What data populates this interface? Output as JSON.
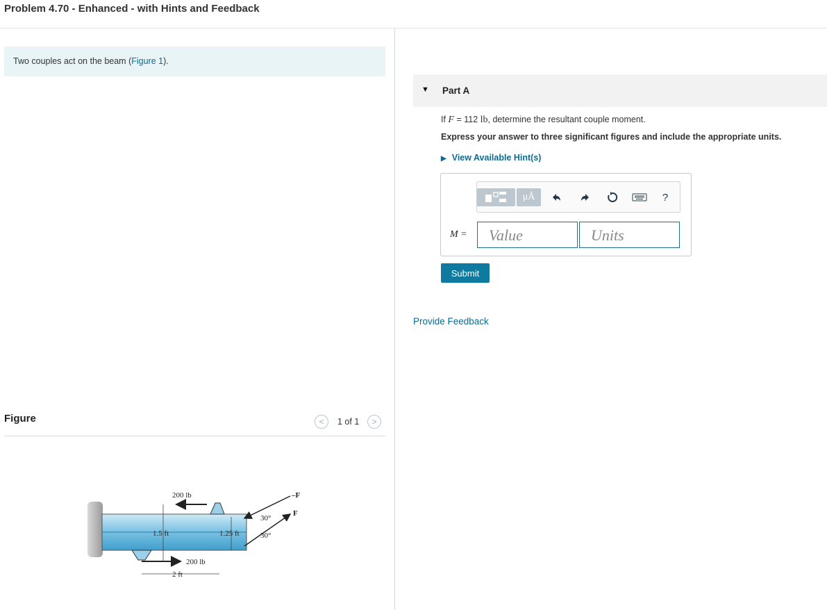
{
  "title": "Problem 4.70 - Enhanced - with Hints and Feedback",
  "intro": {
    "text": "Two couples act on the beam (",
    "link": "Figure 1",
    "end": ")."
  },
  "figure": {
    "label": "Figure",
    "pager": "1 of 1",
    "prev_icon": "chevron-left",
    "next_icon": "chevron-right"
  },
  "diagram": {
    "force_top": "200 lb",
    "force_bottom": "200 lb",
    "dim_left_height": "1.5 ft",
    "dim_right_height": "1.25 ft",
    "dim_width": "2 ft",
    "angle_top": "30°",
    "angle_bottom": "30°",
    "f_top": "–F",
    "f_bottom": "F"
  },
  "part": {
    "label": "Part A",
    "question_prefix": "If ",
    "question_var": "F",
    "question_mid": " = 112 ",
    "question_unit": "lb",
    "question_suffix": ", determine the resultant couple moment.",
    "instruction": "Express your answer to three significant figures and include the appropriate units.",
    "hint_link": "View Available Hint(s)"
  },
  "answer": {
    "label": "M =",
    "value_placeholder": "Value",
    "units_placeholder": "Units",
    "toolbar_icons": [
      "templates-icon",
      "units-icon",
      "undo-icon",
      "redo-icon",
      "reset-icon",
      "keyboard-icon",
      "help-icon"
    ],
    "units_button": "μÅ",
    "help_button": "?"
  },
  "submit": "Submit",
  "feedback_link": "Provide Feedback"
}
